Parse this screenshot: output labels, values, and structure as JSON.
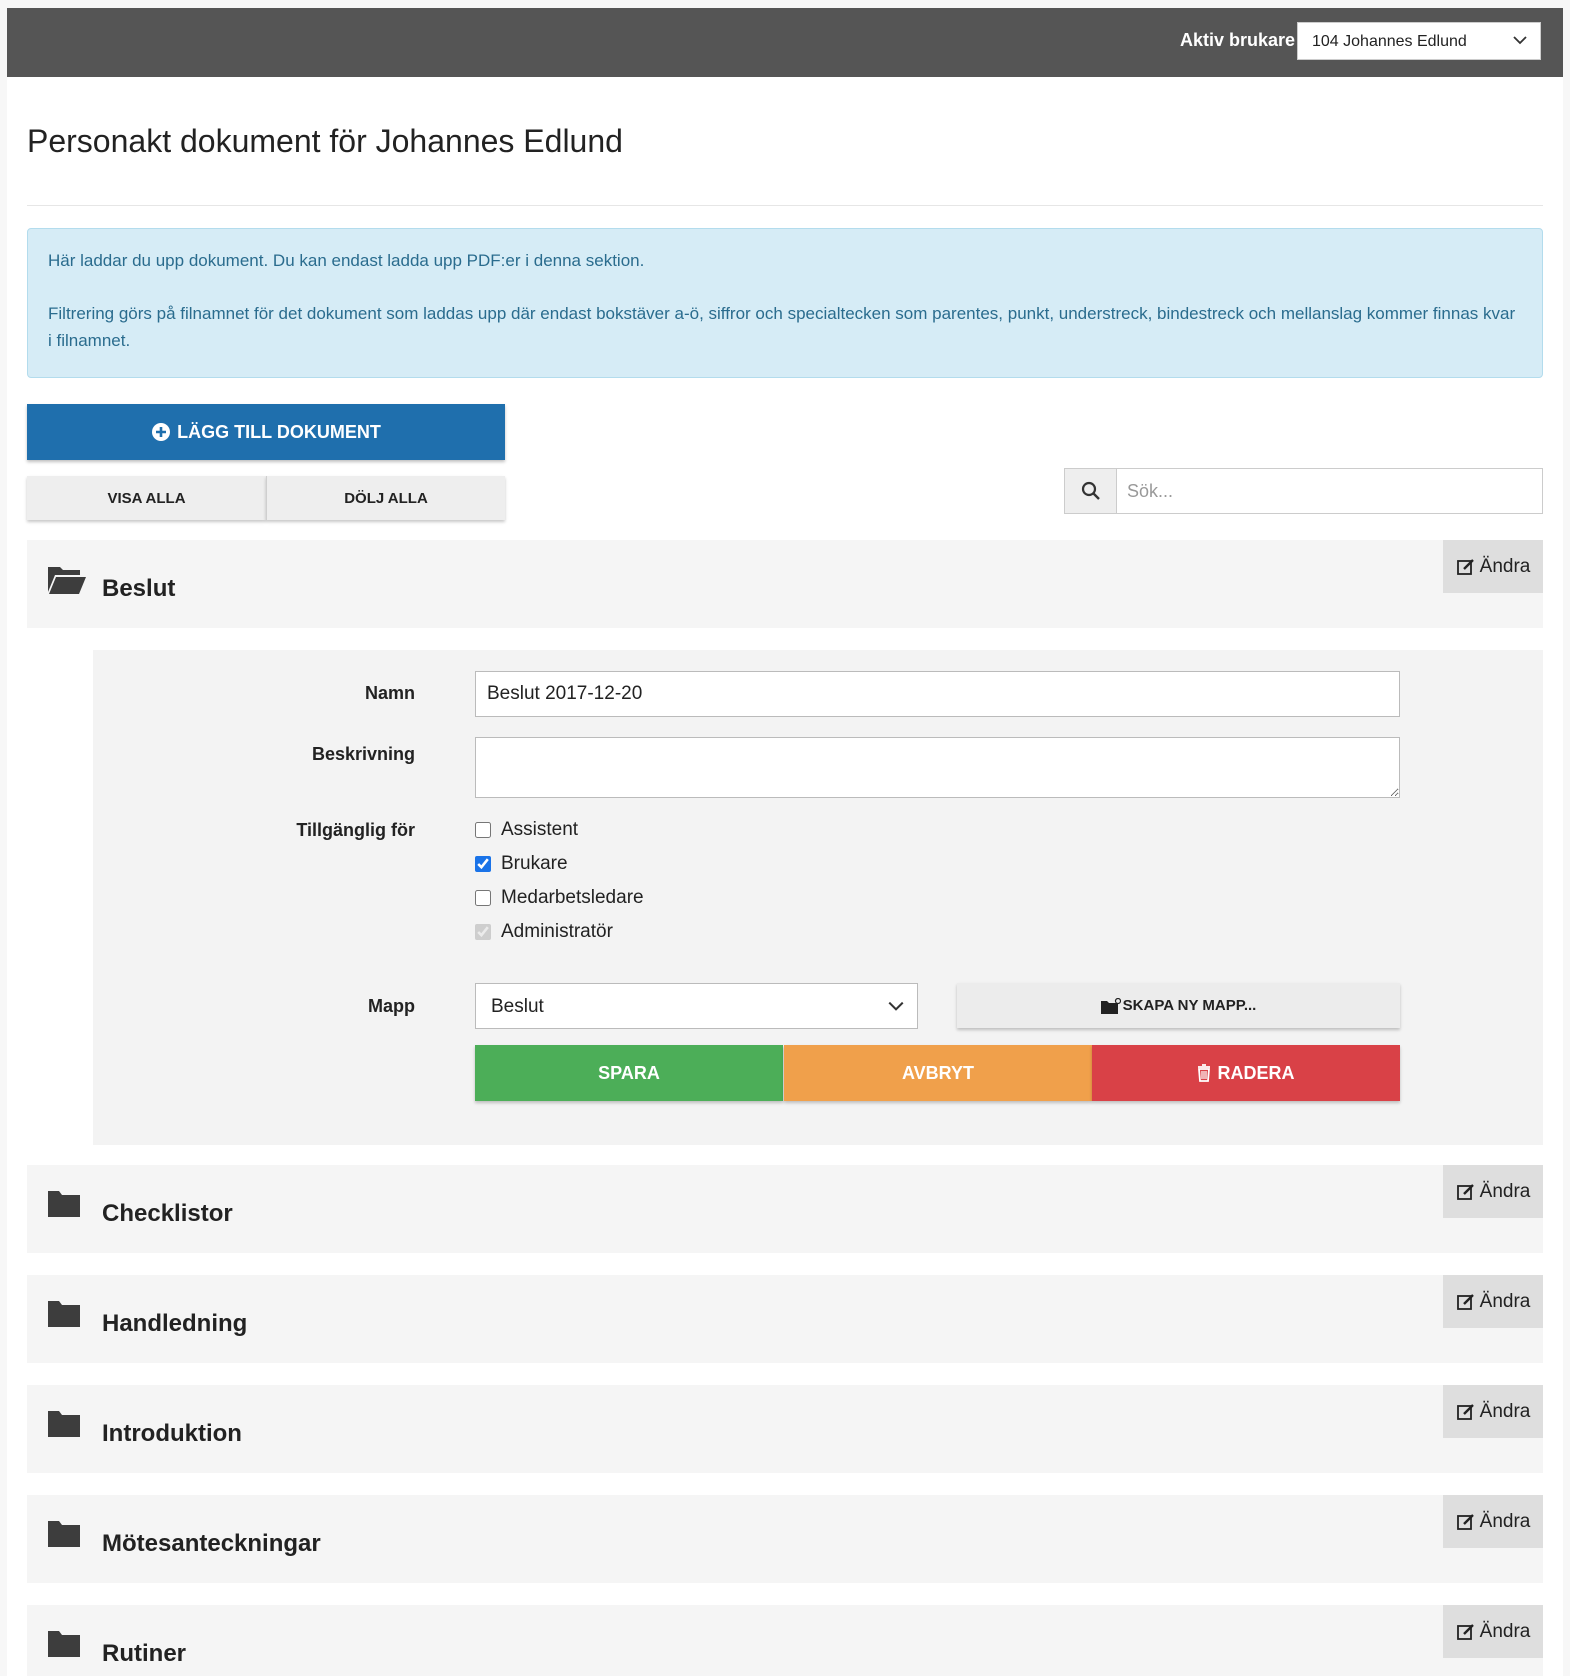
{
  "header": {
    "active_user_label": "Aktiv brukare",
    "active_user_value": "104 Johannes Edlund"
  },
  "page": {
    "title": "Personakt dokument för Johannes Edlund"
  },
  "info": {
    "line1": "Här laddar du upp dokument. Du kan endast ladda upp PDF:er i denna sektion.",
    "line2": "Filtrering görs på filnamnet för det dokument som laddas upp där endast bokstäver a-ö, siffror och specialtecken som parentes, punkt, understreck, bindestreck och mellanslag kommer finnas kvar i filnamnet."
  },
  "toolbar": {
    "add_label": "LÄGG TILL DOKUMENT",
    "show_all_label": "VISA ALLA",
    "hide_all_label": "DÖLJ ALLA",
    "search_placeholder": "Sök..."
  },
  "edit_label": "Ändra",
  "folders": [
    {
      "name": "Beslut",
      "open": true
    },
    {
      "name": "Checklistor",
      "open": false
    },
    {
      "name": "Handledning",
      "open": false
    },
    {
      "name": "Introduktion",
      "open": false
    },
    {
      "name": "Mötesanteckningar",
      "open": false
    },
    {
      "name": "Rutiner",
      "open": false
    }
  ],
  "document_form": {
    "name_label": "Namn",
    "name_value": "Beslut 2017-12-20",
    "description_label": "Beskrivning",
    "description_value": "",
    "available_label": "Tillgänglig för",
    "roles": [
      {
        "label": "Assistent",
        "checked": false,
        "disabled": false
      },
      {
        "label": "Brukare",
        "checked": true,
        "disabled": false
      },
      {
        "label": "Medarbetsledare",
        "checked": false,
        "disabled": false
      },
      {
        "label": "Administratör",
        "checked": true,
        "disabled": true
      }
    ],
    "folder_label": "Mapp",
    "folder_value": "Beslut",
    "new_folder_label": "SKAPA NY MAPP...",
    "save_label": "SPARA",
    "cancel_label": "AVBRYT",
    "delete_label": "RADERA"
  },
  "colors": {
    "header_bg": "#555555",
    "primary": "#1f6fad",
    "save": "#4cae58",
    "cancel": "#f0a04b",
    "delete": "#d94147",
    "info_bg": "#d6ecf6",
    "info_text": "#2a6c8e"
  }
}
